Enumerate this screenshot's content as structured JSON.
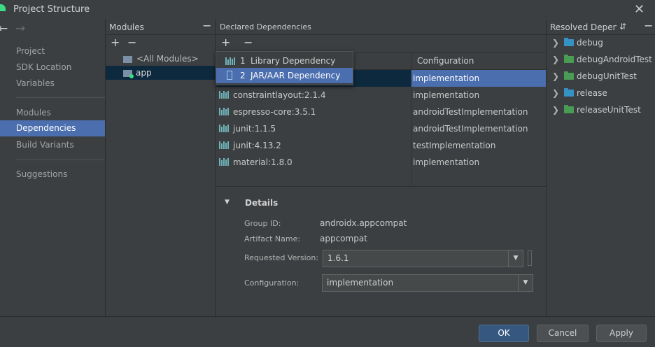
{
  "window": {
    "title": "Project Structure"
  },
  "nav": {
    "back": "←",
    "forward": "→",
    "group1": [
      "Project",
      "SDK Location",
      "Variables"
    ],
    "group2": [
      "Modules",
      "Dependencies",
      "Build Variants"
    ],
    "group3": [
      "Suggestions"
    ],
    "selected": "Dependencies"
  },
  "modules_panel": {
    "header": "Modules",
    "items": [
      "<All Modules>",
      "app"
    ],
    "selected": "app"
  },
  "declared_panel": {
    "header": "Declared Dependencies",
    "columns": [
      "",
      "Configuration"
    ],
    "rows": [
      {
        "name": "",
        "configuration": "implementation"
      },
      {
        "name": "constraintlayout:2.1.4",
        "configuration": "implementation"
      },
      {
        "name": "espresso-core:3.5.1",
        "configuration": "androidTestImplementation"
      },
      {
        "name": "junit:1.1.5",
        "configuration": "androidTestImplementation"
      },
      {
        "name": "junit:4.13.2",
        "configuration": "testImplementation"
      },
      {
        "name": "material:1.8.0",
        "configuration": "implementation"
      }
    ]
  },
  "add_menu": {
    "items": [
      {
        "num": "1",
        "label": "Library Dependency"
      },
      {
        "num": "2",
        "label": "JAR/AAR Dependency"
      }
    ],
    "selected": "JAR/AAR Dependency"
  },
  "details": {
    "title": "Details",
    "group_id_label": "Group ID:",
    "group_id": "androidx.appcompat",
    "artifact_label": "Artifact Name:",
    "artifact": "appcompat",
    "version_label": "Requested Version:",
    "version": "1.6.1",
    "configuration_label": "Configuration:",
    "configuration": "implementation"
  },
  "resolved_panel": {
    "header": "Resolved Depen...",
    "items": [
      {
        "label": "debug",
        "color": "#3592c4"
      },
      {
        "label": "debugAndroidTest",
        "color": "#499c54"
      },
      {
        "label": "debugUnitTest",
        "color": "#499c54"
      },
      {
        "label": "release",
        "color": "#3592c4"
      },
      {
        "label": "releaseUnitTest",
        "color": "#499c54"
      }
    ]
  },
  "buttons": {
    "ok": "OK",
    "cancel": "Cancel",
    "apply": "Apply"
  },
  "colors": {
    "selection": "#4b6eaf",
    "background": "#3c3f41",
    "library_icon": "#6fb3b8"
  },
  "icons": {
    "close": "✕",
    "add": "+",
    "remove": "−",
    "collapse": "▼",
    "expand": "›"
  }
}
